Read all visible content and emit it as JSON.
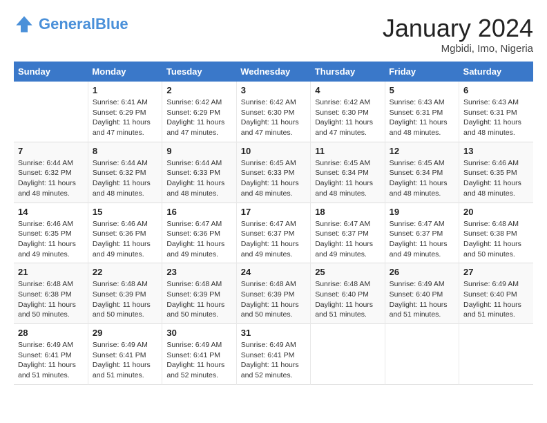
{
  "header": {
    "logo_general": "General",
    "logo_blue": "Blue",
    "month_year": "January 2024",
    "location": "Mgbidi, Imo, Nigeria"
  },
  "columns": [
    "Sunday",
    "Monday",
    "Tuesday",
    "Wednesday",
    "Thursday",
    "Friday",
    "Saturday"
  ],
  "weeks": [
    [
      {
        "day": "",
        "info": ""
      },
      {
        "day": "1",
        "info": "Sunrise: 6:41 AM\nSunset: 6:29 PM\nDaylight: 11 hours\nand 47 minutes."
      },
      {
        "day": "2",
        "info": "Sunrise: 6:42 AM\nSunset: 6:29 PM\nDaylight: 11 hours\nand 47 minutes."
      },
      {
        "day": "3",
        "info": "Sunrise: 6:42 AM\nSunset: 6:30 PM\nDaylight: 11 hours\nand 47 minutes."
      },
      {
        "day": "4",
        "info": "Sunrise: 6:42 AM\nSunset: 6:30 PM\nDaylight: 11 hours\nand 47 minutes."
      },
      {
        "day": "5",
        "info": "Sunrise: 6:43 AM\nSunset: 6:31 PM\nDaylight: 11 hours\nand 48 minutes."
      },
      {
        "day": "6",
        "info": "Sunrise: 6:43 AM\nSunset: 6:31 PM\nDaylight: 11 hours\nand 48 minutes."
      }
    ],
    [
      {
        "day": "7",
        "info": "Sunrise: 6:44 AM\nSunset: 6:32 PM\nDaylight: 11 hours\nand 48 minutes."
      },
      {
        "day": "8",
        "info": "Sunrise: 6:44 AM\nSunset: 6:32 PM\nDaylight: 11 hours\nand 48 minutes."
      },
      {
        "day": "9",
        "info": "Sunrise: 6:44 AM\nSunset: 6:33 PM\nDaylight: 11 hours\nand 48 minutes."
      },
      {
        "day": "10",
        "info": "Sunrise: 6:45 AM\nSunset: 6:33 PM\nDaylight: 11 hours\nand 48 minutes."
      },
      {
        "day": "11",
        "info": "Sunrise: 6:45 AM\nSunset: 6:34 PM\nDaylight: 11 hours\nand 48 minutes."
      },
      {
        "day": "12",
        "info": "Sunrise: 6:45 AM\nSunset: 6:34 PM\nDaylight: 11 hours\nand 48 minutes."
      },
      {
        "day": "13",
        "info": "Sunrise: 6:46 AM\nSunset: 6:35 PM\nDaylight: 11 hours\nand 48 minutes."
      }
    ],
    [
      {
        "day": "14",
        "info": "Sunrise: 6:46 AM\nSunset: 6:35 PM\nDaylight: 11 hours\nand 49 minutes."
      },
      {
        "day": "15",
        "info": "Sunrise: 6:46 AM\nSunset: 6:36 PM\nDaylight: 11 hours\nand 49 minutes."
      },
      {
        "day": "16",
        "info": "Sunrise: 6:47 AM\nSunset: 6:36 PM\nDaylight: 11 hours\nand 49 minutes."
      },
      {
        "day": "17",
        "info": "Sunrise: 6:47 AM\nSunset: 6:37 PM\nDaylight: 11 hours\nand 49 minutes."
      },
      {
        "day": "18",
        "info": "Sunrise: 6:47 AM\nSunset: 6:37 PM\nDaylight: 11 hours\nand 49 minutes."
      },
      {
        "day": "19",
        "info": "Sunrise: 6:47 AM\nSunset: 6:37 PM\nDaylight: 11 hours\nand 49 minutes."
      },
      {
        "day": "20",
        "info": "Sunrise: 6:48 AM\nSunset: 6:38 PM\nDaylight: 11 hours\nand 50 minutes."
      }
    ],
    [
      {
        "day": "21",
        "info": "Sunrise: 6:48 AM\nSunset: 6:38 PM\nDaylight: 11 hours\nand 50 minutes."
      },
      {
        "day": "22",
        "info": "Sunrise: 6:48 AM\nSunset: 6:39 PM\nDaylight: 11 hours\nand 50 minutes."
      },
      {
        "day": "23",
        "info": "Sunrise: 6:48 AM\nSunset: 6:39 PM\nDaylight: 11 hours\nand 50 minutes."
      },
      {
        "day": "24",
        "info": "Sunrise: 6:48 AM\nSunset: 6:39 PM\nDaylight: 11 hours\nand 50 minutes."
      },
      {
        "day": "25",
        "info": "Sunrise: 6:48 AM\nSunset: 6:40 PM\nDaylight: 11 hours\nand 51 minutes."
      },
      {
        "day": "26",
        "info": "Sunrise: 6:49 AM\nSunset: 6:40 PM\nDaylight: 11 hours\nand 51 minutes."
      },
      {
        "day": "27",
        "info": "Sunrise: 6:49 AM\nSunset: 6:40 PM\nDaylight: 11 hours\nand 51 minutes."
      }
    ],
    [
      {
        "day": "28",
        "info": "Sunrise: 6:49 AM\nSunset: 6:41 PM\nDaylight: 11 hours\nand 51 minutes."
      },
      {
        "day": "29",
        "info": "Sunrise: 6:49 AM\nSunset: 6:41 PM\nDaylight: 11 hours\nand 51 minutes."
      },
      {
        "day": "30",
        "info": "Sunrise: 6:49 AM\nSunset: 6:41 PM\nDaylight: 11 hours\nand 52 minutes."
      },
      {
        "day": "31",
        "info": "Sunrise: 6:49 AM\nSunset: 6:41 PM\nDaylight: 11 hours\nand 52 minutes."
      },
      {
        "day": "",
        "info": ""
      },
      {
        "day": "",
        "info": ""
      },
      {
        "day": "",
        "info": ""
      }
    ]
  ]
}
